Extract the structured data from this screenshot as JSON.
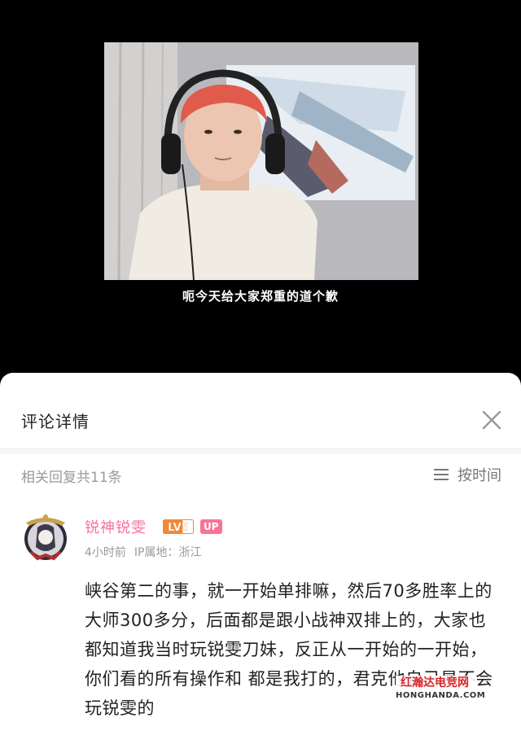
{
  "video": {
    "subtitle": "呃今天给大家郑重的道个歉"
  },
  "sheet": {
    "title": "评论详情",
    "reply_count": "相关回复共11条",
    "sort_label": "按时间"
  },
  "comment": {
    "username": "锐神锐雯",
    "level": "LV5",
    "up_badge": "UP",
    "time": "4小时前",
    "ip_location": "IP属地：浙江",
    "text": "峡谷第二的事，就一开始单排嘛，然后70多胜率上的大师300多分，后面都是跟小战神双排上的，大家也都知道我当时玩锐雯刀妹，反正从一开始的一开始，你们看的所有操作和      都是我打的，君克他自己是不会玩锐雯的"
  },
  "watermark": {
    "cn": "红瀚达电竞网",
    "en": "HONGHANDA.COM"
  },
  "colors": {
    "accent_pink": "#fb7299",
    "level_orange": "#f08a3a",
    "watermark_red": "#d9262a"
  }
}
